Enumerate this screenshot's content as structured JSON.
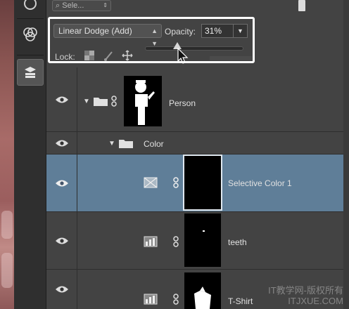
{
  "filter": {
    "label": "Sele..."
  },
  "blend_mode": {
    "value": "Linear Dodge (Add)"
  },
  "opacity": {
    "label": "Opacity:",
    "value": "31%"
  },
  "lock": {
    "label": "Lock:"
  },
  "layers": [
    {
      "name": "Person",
      "kind": "group"
    },
    {
      "name": "Color",
      "kind": "group"
    },
    {
      "name": "Selective Color 1",
      "kind": "adjustment"
    },
    {
      "name": "teeth",
      "kind": "adjustment"
    },
    {
      "name": "T-Shirt",
      "kind": "adjustment"
    }
  ],
  "selected_layer": "Selective Color 1",
  "watermark": {
    "line1": "IT教学网-版权所有",
    "line2": "ITJXUE.COM"
  },
  "colors": {
    "selected_row": "#5f7e98",
    "panel": "#434343",
    "highlight": "#ffffff"
  }
}
